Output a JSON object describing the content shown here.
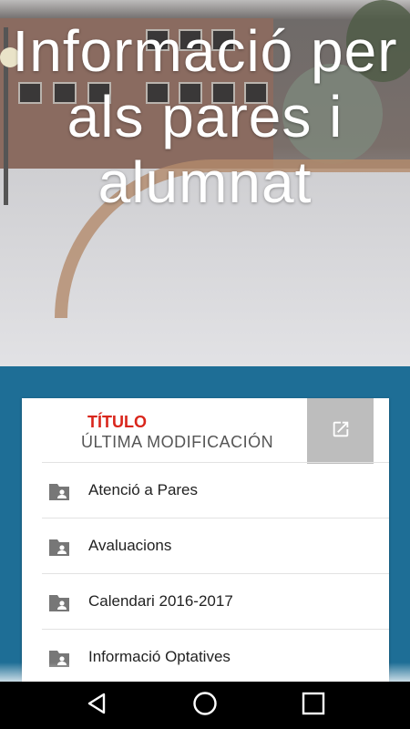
{
  "hero": {
    "title": "Informació per als pares i alumnat"
  },
  "card": {
    "header_title": "TÍTULO",
    "header_subtitle": "ÚLTIMA MODIFICACIÓN",
    "open_icon": "open-in-new-icon",
    "items": [
      {
        "label": "Atenció a Pares",
        "icon": "folder-shared-icon"
      },
      {
        "label": "Avaluacions",
        "icon": "folder-shared-icon"
      },
      {
        "label": "Calendari 2016-2017",
        "icon": "folder-shared-icon"
      },
      {
        "label": "Informació Optatives",
        "icon": "folder-shared-icon"
      }
    ]
  },
  "navbar": {
    "back_icon": "back-triangle-icon",
    "home_icon": "home-circle-icon",
    "recents_icon": "recents-square-icon"
  },
  "colors": {
    "accent_red": "#d9261c",
    "background_blue": "#1e6e96",
    "button_gray": "#bdbdbd"
  }
}
